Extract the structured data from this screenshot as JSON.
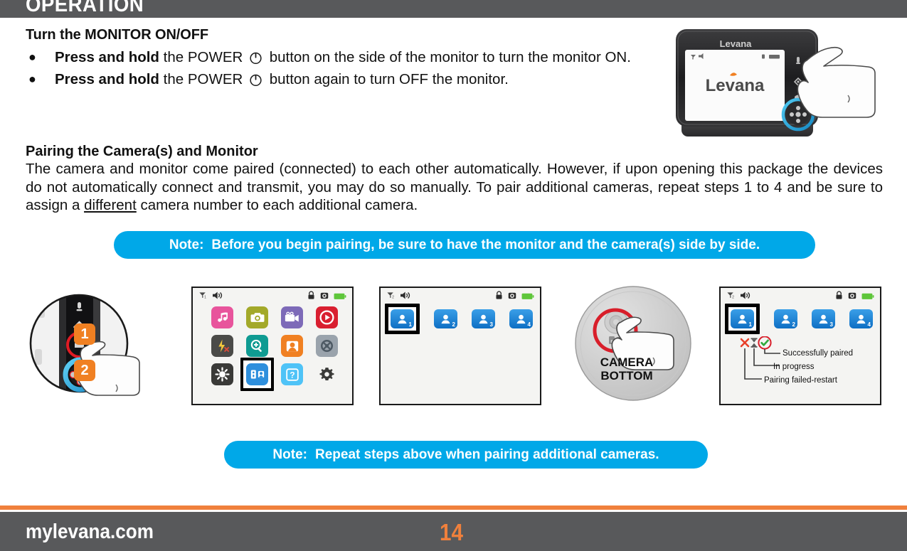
{
  "header": {
    "title": "OPERATION"
  },
  "section1": {
    "heading": "Turn the MONITOR ON/OFF",
    "bullets": [
      {
        "bold": "Press and hold",
        "before": " the POWER ",
        "icon": "power-icon",
        "after": " button on the side of the monitor to turn the monitor ON."
      },
      {
        "bold": "Press and hold",
        "before": " the POWER ",
        "icon": "power-icon",
        "after": " button again to turn OFF the monitor."
      }
    ]
  },
  "section2": {
    "heading": "Pairing the Camera(s) and Monitor",
    "paragraph_part1": "The camera and monitor come paired (connected) to each other automatically.  However, if upon opening this package the devices do not automatically connect and transmit, you may do so manually. To pair additional cameras, repeat steps 1 to 4 and be sure to assign a ",
    "paragraph_underlined": "different",
    "paragraph_part2": " camera number to each additional camera."
  },
  "notes": {
    "top": {
      "label": "Note:",
      "text": "Before you begin pairing, be sure to have the monitor and the camera(s) side by side."
    },
    "bottom": {
      "label": "Note:",
      "text": "Repeat steps above when pairing additional cameras."
    }
  },
  "steps": {
    "badge1": "1",
    "badge2": "2"
  },
  "panel_menu": {
    "statusbar": {
      "left_icons": [
        "signal-icon",
        "volume-icon"
      ],
      "right_icons": [
        "lock-icon",
        "camera-icon",
        "battery-icon"
      ]
    },
    "icons": [
      {
        "name": "lullaby-icon",
        "label": "Lullaby",
        "color": "#e8549c",
        "selected": false
      },
      {
        "name": "photo-icon",
        "label": "Photo",
        "color": "#a3a92a",
        "selected": false
      },
      {
        "name": "video-icon",
        "label": "Video",
        "color": "#7d6ab8",
        "selected": false
      },
      {
        "name": "playback-icon",
        "label": "Playback",
        "color": "#d91f30",
        "selected": false
      },
      {
        "name": "nightlight-off-icon",
        "label": "Light Off",
        "color": "#4a4a48",
        "selected": false
      },
      {
        "name": "zoom-icon",
        "label": "Zoom",
        "color": "#0f9b92",
        "selected": false
      },
      {
        "name": "camera-view-icon",
        "label": "Camera View",
        "color": "#f08022",
        "selected": false
      },
      {
        "name": "pan-tilt-icon",
        "label": "Pan / Tilt",
        "color": "#9aa3ac",
        "selected": false
      },
      {
        "name": "brightness-icon",
        "label": "Brightness",
        "color": "#3a3a38",
        "selected": false
      },
      {
        "name": "pairing-icon",
        "label": "Pairing",
        "color": "#2e8fdd",
        "selected": true
      },
      {
        "name": "help-icon",
        "label": "Help",
        "color": "#4fc3f7",
        "selected": false
      },
      {
        "name": "settings-icon",
        "label": "Settings",
        "color": "#e8e8e6",
        "selected": false
      }
    ]
  },
  "panel_cams": {
    "cameras": [
      {
        "number": "1",
        "selected": true
      },
      {
        "number": "2",
        "selected": false
      },
      {
        "number": "3",
        "selected": false
      },
      {
        "number": "4",
        "selected": false
      }
    ]
  },
  "panel_camera_bottom": {
    "label_line1": "CAMERA",
    "label_line2": "BOTTOM"
  },
  "panel_status": {
    "cameras": [
      {
        "number": "1",
        "selected": true
      },
      {
        "number": "2",
        "selected": false
      },
      {
        "number": "3",
        "selected": false
      },
      {
        "number": "4",
        "selected": false
      }
    ],
    "legend": [
      {
        "icon": "check-circle-icon",
        "text": "Successfully paired"
      },
      {
        "icon": "hourglass-icon",
        "text": "In progress"
      },
      {
        "icon": "x-mark-icon",
        "text": "Pairing failed-restart"
      }
    ]
  },
  "monitor_illustration": {
    "brand": "Levana",
    "screen_brand": "Levana"
  },
  "footer": {
    "website": "mylevana.com",
    "page_number": "14"
  },
  "colors": {
    "header_gray": "#58595b",
    "accent_orange": "#f0803c",
    "note_blue": "#00a8e8",
    "badge_orange": "#f08022"
  }
}
